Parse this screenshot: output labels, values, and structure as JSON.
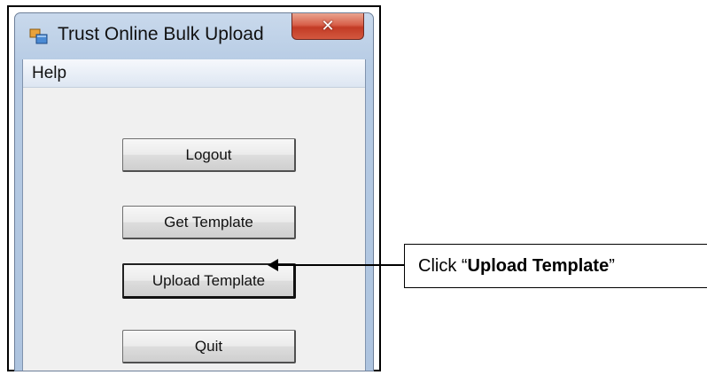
{
  "window": {
    "title": "Trust Online Bulk Upload",
    "close_glyph": "✕",
    "icon": "app-window-icon"
  },
  "menu": {
    "items": [
      {
        "label": "Help"
      }
    ]
  },
  "buttons": {
    "logout": "Logout",
    "get_template": "Get Template",
    "upload_template": "Upload Template",
    "quit": "Quit"
  },
  "callout": {
    "prefix": "Click “",
    "emphasis": "Upload Template",
    "suffix": "”"
  },
  "colors": {
    "titlebar": "#b6cbe4",
    "close_button": "#c23b25",
    "client_background": "#f0f0f0"
  }
}
